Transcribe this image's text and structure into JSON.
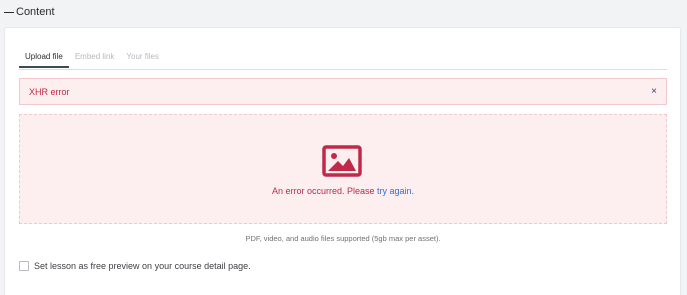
{
  "section": {
    "title": "Content"
  },
  "tabs": [
    {
      "label": "Upload file",
      "active": true
    },
    {
      "label": "Embed link",
      "active": false
    },
    {
      "label": "Your files",
      "active": false
    }
  ],
  "alert": {
    "message": "XHR error",
    "close_symbol": "×",
    "close_icon": "close-icon"
  },
  "dropzone": {
    "icon": "image-icon",
    "message_prefix": "An error occurred. Please ",
    "retry_link": "try again",
    "message_suffix": "."
  },
  "support_note": "PDF, video, and audio files supported (5gb max per asset).",
  "free_preview": {
    "label": "Set lesson as free preview on your course detail page.",
    "checked": false
  },
  "colors": {
    "error": "#c02a48",
    "error_bg": "#fdeef0",
    "link": "#2f6fd0"
  }
}
